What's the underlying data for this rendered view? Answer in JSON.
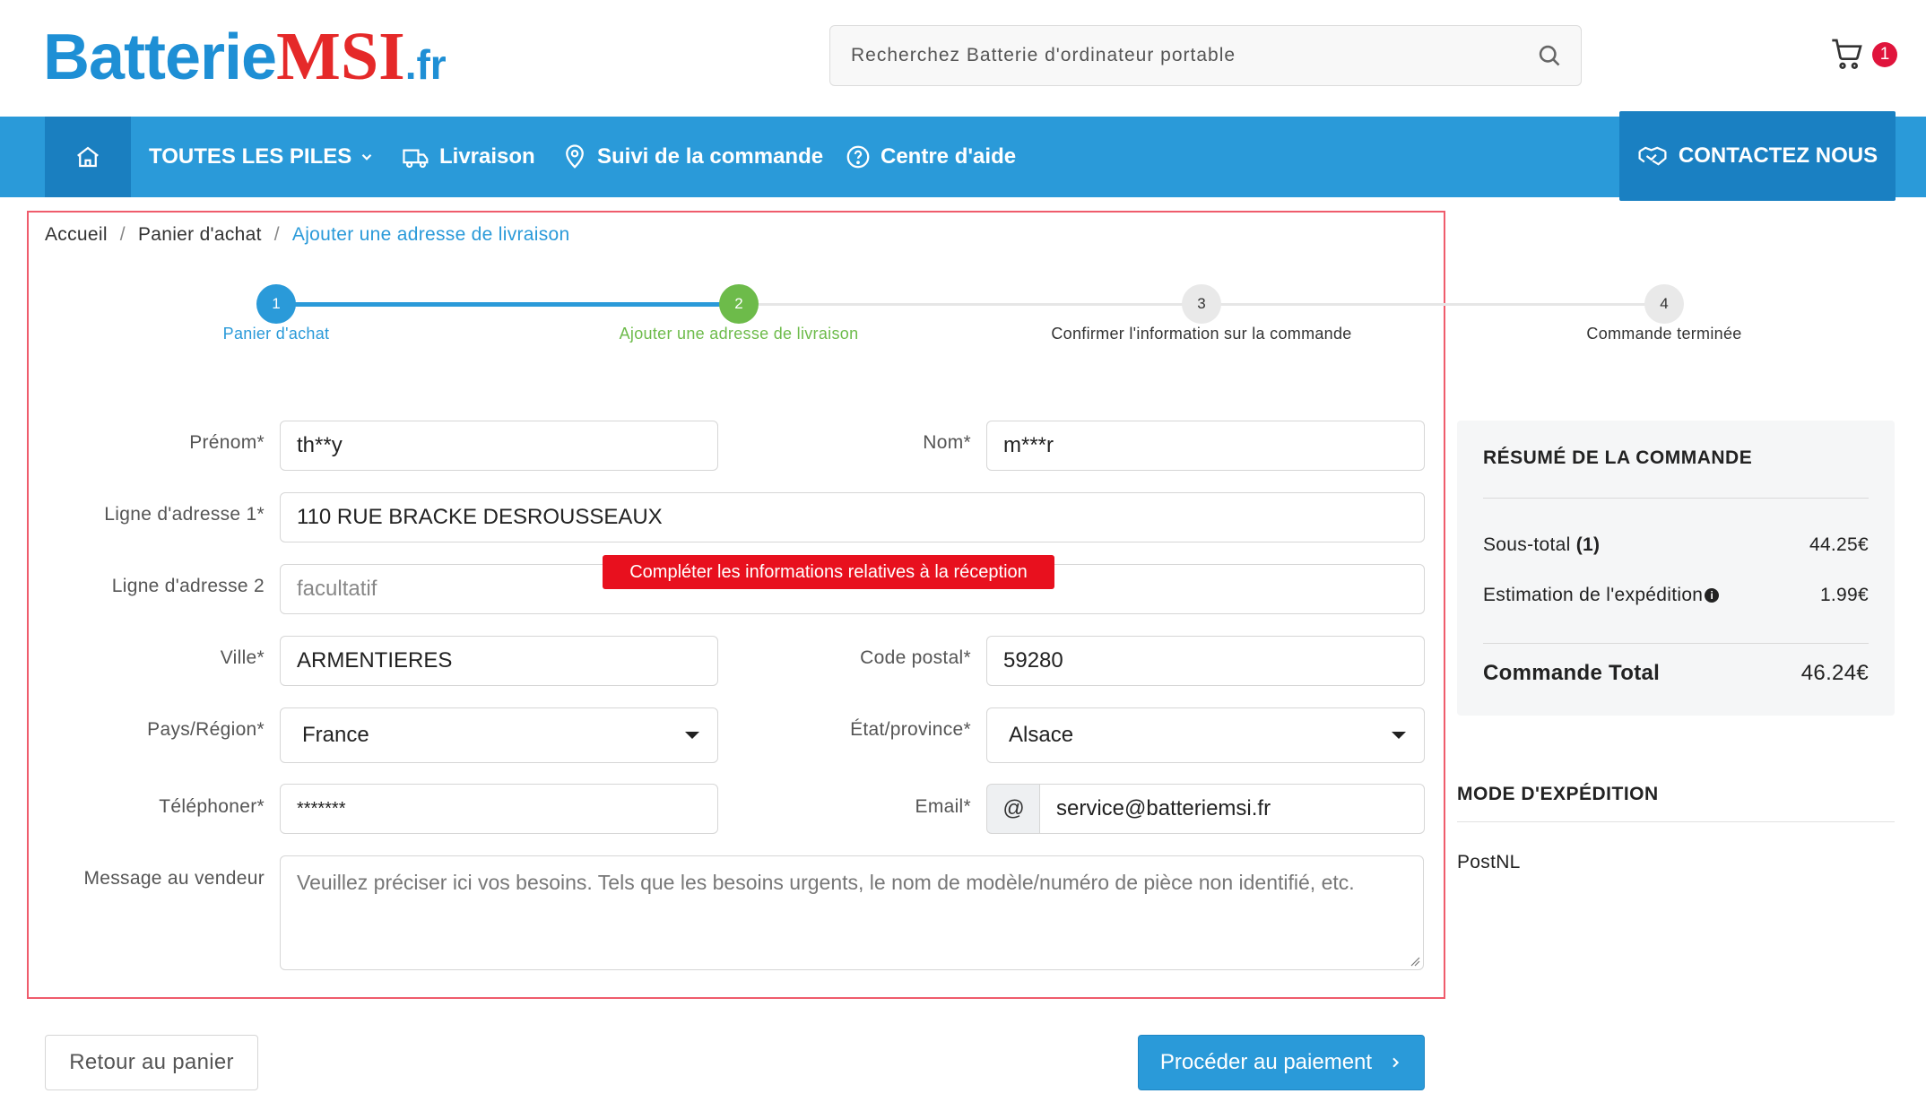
{
  "logo": {
    "part1": "Batterie",
    "part2": "MSI",
    "part3": ".fr"
  },
  "search": {
    "placeholder": "Recherchez Batterie d'ordinateur portable"
  },
  "cart": {
    "count": "1"
  },
  "nav": {
    "all_piles": "TOUTES LES PILES",
    "livraison": "Livraison",
    "suivi": "Suivi de la commande",
    "aide": "Centre d'aide",
    "contact": "CONTACTEZ NOUS"
  },
  "breadcrumb": {
    "home": "Accueil",
    "cart": "Panier d'achat",
    "current": "Ajouter une adresse de livraison",
    "sep": "/"
  },
  "steps": [
    {
      "num": "1",
      "label": "Panier d'achat"
    },
    {
      "num": "2",
      "label": "Ajouter une adresse de livraison"
    },
    {
      "num": "3",
      "label": "Confirmer l'information sur la commande"
    },
    {
      "num": "4",
      "label": "Commande terminée"
    }
  ],
  "form": {
    "prenom_label": "Prénom*",
    "prenom_value": "th**y",
    "nom_label": "Nom*",
    "nom_value": "m***r",
    "addr1_label": "Ligne d'adresse 1*",
    "addr1_value": "110 RUE BRACKE DESROUSSEAUX",
    "addr2_label": "Ligne d'adresse 2",
    "addr2_placeholder": "facultatif",
    "ville_label": "Ville*",
    "ville_value": "ARMENTIERES",
    "cp_label": "Code postal*",
    "cp_value": "59280",
    "pays_label": "Pays/Région*",
    "pays_value": "France",
    "etat_label": "État/province*",
    "etat_value": "Alsace",
    "tel_label": "Téléphoner*",
    "tel_value": "*******",
    "email_label": "Email*",
    "email_prefix": "@",
    "email_value": "service@batteriemsi.fr",
    "msg_label": "Message au vendeur",
    "msg_placeholder": "Veuillez préciser ici vos besoins. Tels que les besoins urgents, le nom de modèle/numéro de pièce non identifié, etc.",
    "tooltip": "Compléter les informations relatives à la réception"
  },
  "buttons": {
    "back": "Retour au panier",
    "pay": "Procéder au paiement"
  },
  "summary": {
    "title": "RÉSUMÉ DE LA COMMANDE",
    "subtotal_label": "Sous-total",
    "subtotal_count": "(1)",
    "subtotal_value": "44.25€",
    "shipping_label": "Estimation de l'expédition",
    "shipping_value": "1.99€",
    "total_label": "Commande Total",
    "total_value": "46.24€"
  },
  "shipping": {
    "title": "MODE D'EXPÉDITION",
    "method": "PostNL"
  },
  "colors": {
    "brand_blue": "#2a9ad9",
    "dark_blue": "#1a7fc0",
    "step_green": "#6dbb4a",
    "error_red": "#e8101e"
  }
}
